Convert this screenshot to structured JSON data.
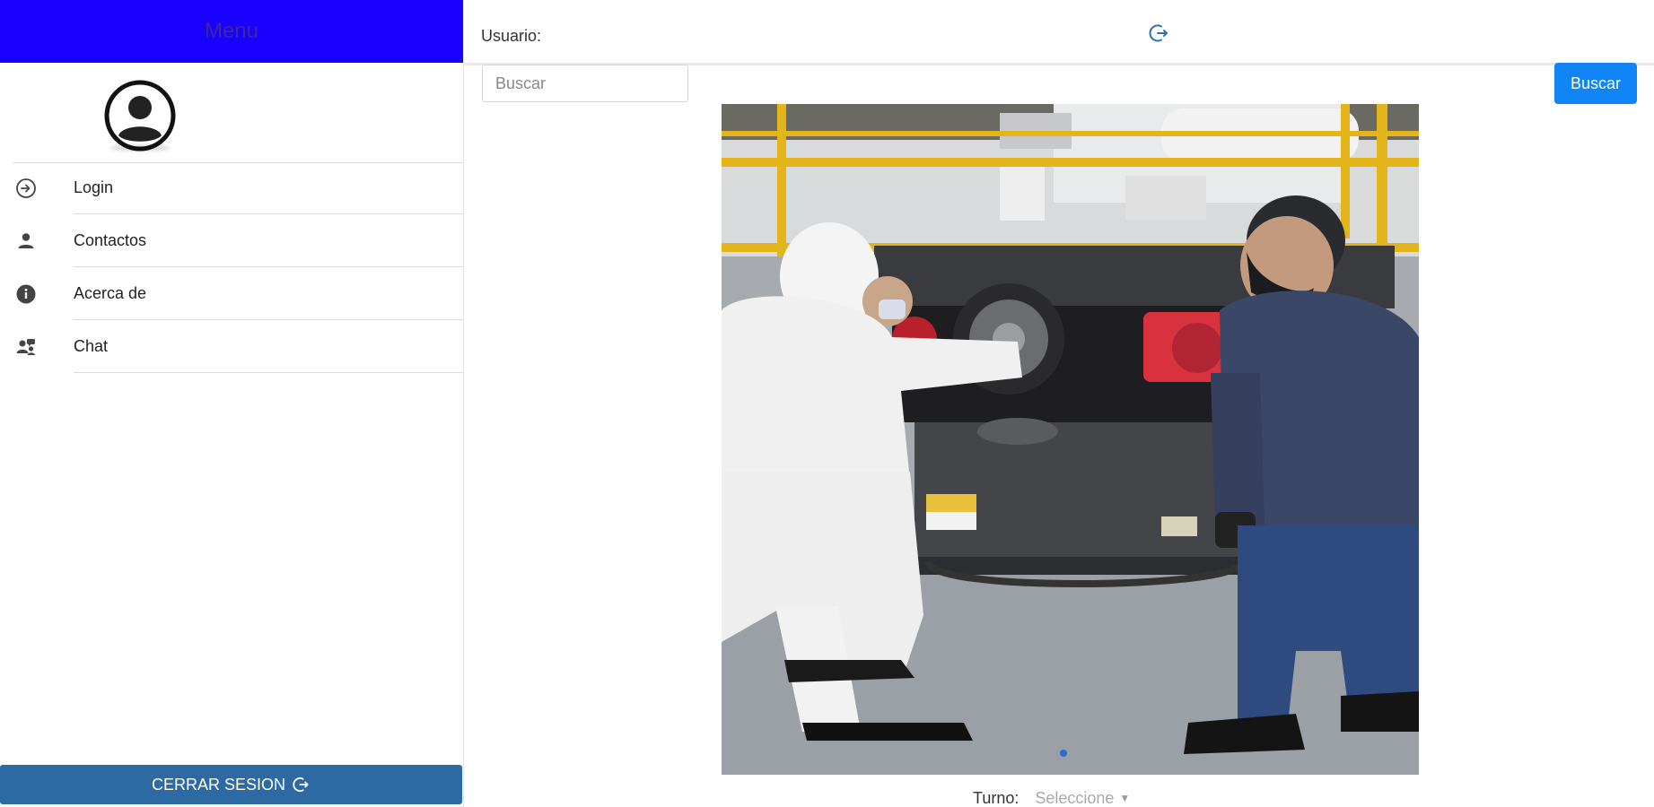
{
  "sidebar": {
    "title": "Menu",
    "avatar_icon": "account-circle-icon",
    "items": [
      {
        "label": "Login",
        "icon": "login-icon"
      },
      {
        "label": "Contactos",
        "icon": "person-icon"
      },
      {
        "label": "Acerca de",
        "icon": "info-icon"
      },
      {
        "label": "Chat",
        "icon": "chat-users-icon"
      }
    ],
    "logout_label": "CERRAR SESION",
    "colors": {
      "header": "#1a00ff",
      "logout": "#2d6aa4"
    }
  },
  "topbar": {
    "user_label": "Usuario:",
    "logout_icon": "logout-icon"
  },
  "search": {
    "placeholder": "Buscar",
    "value": "",
    "button_label": "Buscar",
    "button_color": "#1185f5"
  },
  "carousel": {
    "image_alt": "Dos trabajadores junto a una maquina industrial",
    "active_index": 0
  },
  "form": {
    "turno_label": "Turno:",
    "turno_value": "Seleccione"
  }
}
